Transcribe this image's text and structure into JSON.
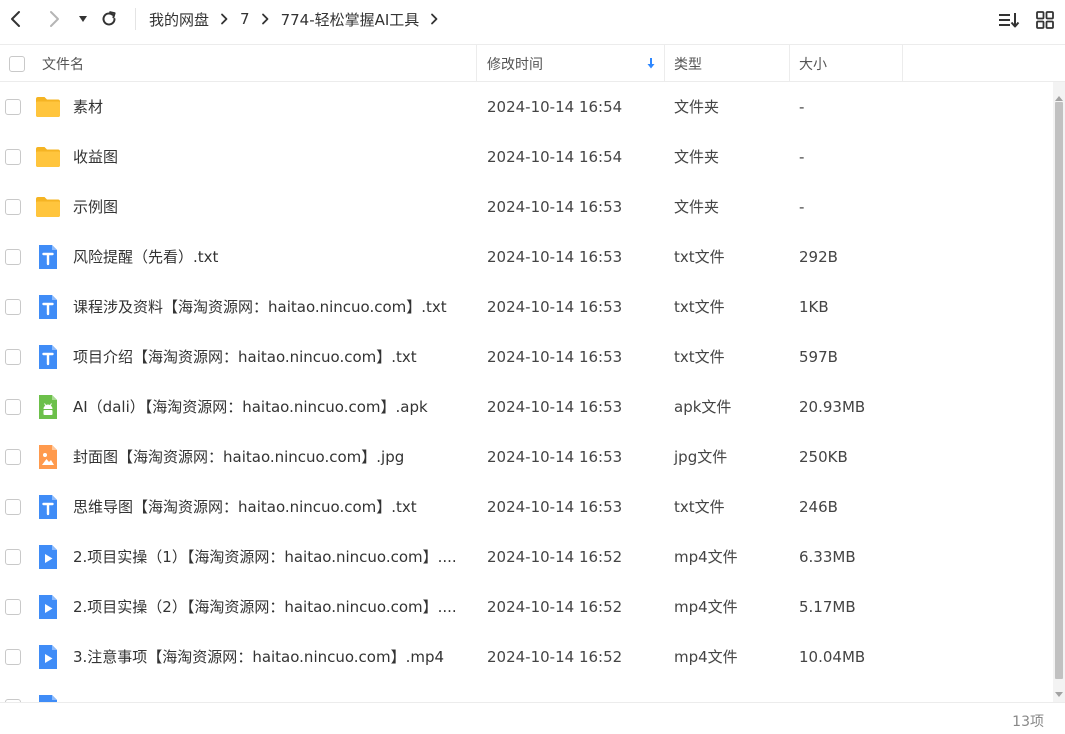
{
  "breadcrumb": {
    "items": [
      "我的网盘",
      "7",
      "774-轻松掌握AI工具"
    ]
  },
  "header": {
    "name": "文件名",
    "mtime": "修改时间",
    "type": "类型",
    "size": "大小"
  },
  "files": [
    {
      "name": "素材",
      "mtime": "2024-10-14 16:54",
      "type": "文件夹",
      "size": "-",
      "icon": "folder-icon"
    },
    {
      "name": "收益图",
      "mtime": "2024-10-14 16:54",
      "type": "文件夹",
      "size": "-",
      "icon": "folder-icon"
    },
    {
      "name": "示例图",
      "mtime": "2024-10-14 16:53",
      "type": "文件夹",
      "size": "-",
      "icon": "folder-icon"
    },
    {
      "name": "风险提醒（先看）.txt",
      "mtime": "2024-10-14 16:53",
      "type": "txt文件",
      "size": "292B",
      "icon": "txt-file-icon"
    },
    {
      "name": "课程涉及资料【海淘资源网：haitao.nincuo.com】.txt",
      "mtime": "2024-10-14 16:53",
      "type": "txt文件",
      "size": "1KB",
      "icon": "txt-file-icon"
    },
    {
      "name": "项目介绍【海淘资源网：haitao.nincuo.com】.txt",
      "mtime": "2024-10-14 16:53",
      "type": "txt文件",
      "size": "597B",
      "icon": "txt-file-icon"
    },
    {
      "name": "AI（dali）【海淘资源网：haitao.nincuo.com】.apk",
      "mtime": "2024-10-14 16:53",
      "type": "apk文件",
      "size": "20.93MB",
      "icon": "apk-file-icon"
    },
    {
      "name": "封面图【海淘资源网：haitao.nincuo.com】.jpg",
      "mtime": "2024-10-14 16:53",
      "type": "jpg文件",
      "size": "250KB",
      "icon": "image-file-icon"
    },
    {
      "name": "思维导图【海淘资源网：haitao.nincuo.com】.txt",
      "mtime": "2024-10-14 16:53",
      "type": "txt文件",
      "size": "246B",
      "icon": "txt-file-icon"
    },
    {
      "name": "2.项目实操（1）【海淘资源网：haitao.nincuo.com】....",
      "mtime": "2024-10-14 16:52",
      "type": "mp4文件",
      "size": "6.33MB",
      "icon": "video-file-icon"
    },
    {
      "name": "2.项目实操（2）【海淘资源网：haitao.nincuo.com】....",
      "mtime": "2024-10-14 16:52",
      "type": "mp4文件",
      "size": "5.17MB",
      "icon": "video-file-icon"
    },
    {
      "name": "3.注意事项【海淘资源网：haitao.nincuo.com】.mp4",
      "mtime": "2024-10-14 16:52",
      "type": "mp4文件",
      "size": "10.04MB",
      "icon": "video-file-icon"
    }
  ],
  "footer": {
    "count": "13项"
  },
  "colors": {
    "folder": "#FFC53D",
    "txt": "#3F8CF7",
    "apk": "#6CC04A",
    "image": "#FF9A4D",
    "video": "#3F8CF7",
    "sort_arrow": "#2F88FF"
  }
}
